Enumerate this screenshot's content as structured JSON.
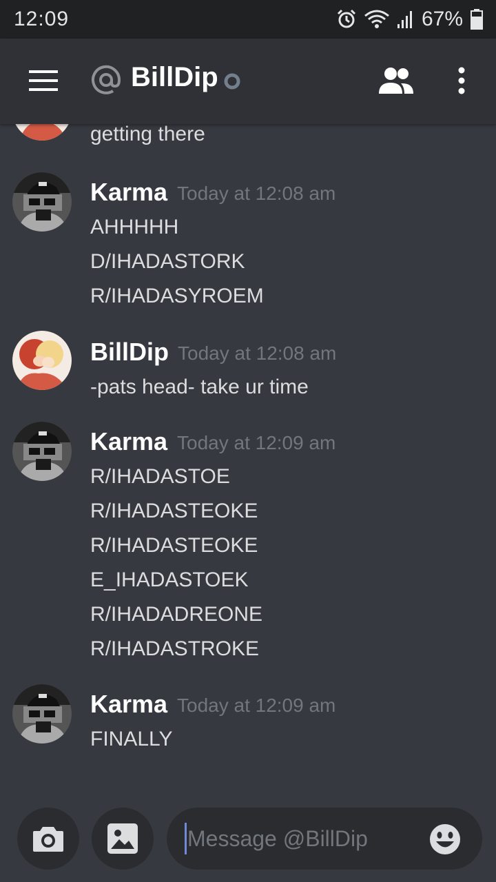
{
  "status_bar": {
    "time": "12:09",
    "battery": "67%",
    "icons": [
      "alarm-icon",
      "wifi-icon",
      "signal-icon",
      "battery-icon"
    ]
  },
  "header": {
    "channel_name": "BillDip",
    "icons": [
      "menu-icon",
      "at-icon",
      "status-dot-icon",
      "members-icon",
      "more-icon"
    ]
  },
  "colors": {
    "background": "#36393f",
    "header": "#2f3136",
    "status_bar": "#1f2123",
    "text": "#dcddde",
    "muted": "#72767d",
    "accent": "#7289da"
  },
  "messages": [
    {
      "author": "",
      "timestamp": "",
      "lines": [
        "getting there"
      ]
    },
    {
      "author": "Karma",
      "timestamp": "Today at 12:08 am",
      "lines": [
        "AHHHHH",
        "D/IHADASTORK",
        "R/IHADASYROEM"
      ]
    },
    {
      "author": "BillDip",
      "timestamp": "Today at 12:08 am",
      "lines": [
        "-pats head- take ur time"
      ]
    },
    {
      "author": "Karma",
      "timestamp": "Today at 12:09 am",
      "lines": [
        "R/IHADASTOE",
        "R/IHADASTEOKE",
        "R/IHADASTEOKE",
        "E_IHADASTOEK",
        "R/IHADADREONE",
        "R/IHADASTROKE"
      ]
    },
    {
      "author": "Karma",
      "timestamp": "Today at 12:09 am",
      "lines": [
        "FINALLY"
      ]
    }
  ],
  "composer": {
    "placeholder": "Message @BillDip",
    "value": "",
    "icons": [
      "camera-icon",
      "image-icon",
      "emoji-icon"
    ]
  }
}
